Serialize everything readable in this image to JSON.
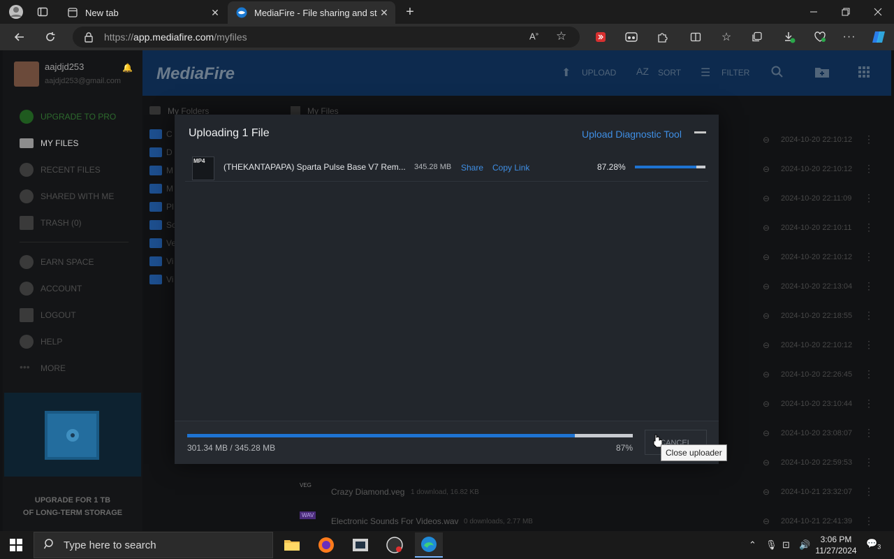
{
  "browser": {
    "tabs": [
      {
        "title": "New tab",
        "close": "✕"
      },
      {
        "title": "MediaFire - File sharing and stora",
        "close": "✕"
      }
    ],
    "new_tab": "+",
    "url_prefix": "https://",
    "url_host": "app.mediafire.com",
    "url_path": "/myfiles"
  },
  "sidebar": {
    "user_name": "aajdjd253",
    "user_email": "aajdjd253@gmail.com",
    "items": [
      {
        "label": "UPGRADE TO PRO"
      },
      {
        "label": "MY FILES"
      },
      {
        "label": "RECENT FILES"
      },
      {
        "label": "SHARED WITH ME"
      },
      {
        "label": "TRASH (0)"
      },
      {
        "label": "EARN SPACE"
      },
      {
        "label": "ACCOUNT"
      },
      {
        "label": "LOGOUT"
      },
      {
        "label": "HELP"
      },
      {
        "label": "MORE"
      }
    ],
    "promo_line1": "UPGRADE FOR 1 TB",
    "promo_line2": "OF LONG-TERM STORAGE"
  },
  "topbar": {
    "logo": "MediaFire",
    "upload": "UPLOAD",
    "sort": "SORT",
    "filter": "FILTER"
  },
  "breadcrumbs": {
    "left": "My Folders",
    "right": "My Files"
  },
  "folders": [
    "C",
    "D",
    "M",
    "M",
    "Pl",
    "So",
    "Ve",
    "Vi",
    "Vi"
  ],
  "rows": [
    {
      "date": "2024-10-20 22:10:12"
    },
    {
      "date": "2024-10-20 22:10:12"
    },
    {
      "date": "2024-10-20 22:11:09"
    },
    {
      "date": "2024-10-20 22:10:11"
    },
    {
      "date": "2024-10-20 22:10:12"
    },
    {
      "date": "2024-10-20 22:13:04"
    },
    {
      "date": "2024-10-20 22:18:55"
    },
    {
      "date": "2024-10-20 22:10:12"
    },
    {
      "date": "2024-10-20 22:26:45"
    },
    {
      "date": "2024-10-20 23:10:44"
    },
    {
      "date": "2024-10-20 23:08:07"
    },
    {
      "date": "2024-10-20 22:59:53"
    },
    {
      "date": "2024-10-21 23:32:07"
    },
    {
      "date": "2024-10-21 22:41:39"
    }
  ],
  "visible_files": [
    {
      "tag": "VEG",
      "name": "Crazy Diamond.veg",
      "meta": "1 download, 16.82 KB"
    },
    {
      "tag": "WAV",
      "name": "Electronic Sounds For Videos.wav",
      "meta": "0 downloads, 2.77 MB"
    }
  ],
  "uploader": {
    "title": "Uploading 1 File",
    "diagnostic": "Upload Diagnostic Tool",
    "file_type": "MP4",
    "file_name": "(THEKANTAPAPA) Sparta Pulse Base V7 Rem...",
    "file_size": "345.28 MB",
    "share": "Share",
    "copy_link": "Copy Link",
    "file_percent_text": "87.28%",
    "file_progress": 0.8728,
    "total_text": "301.34 MB / 345.28 MB",
    "total_percent_text": "87%",
    "total_progress": 0.87,
    "cancel": "CANCEL",
    "tooltip": "Close uploader"
  },
  "taskbar": {
    "search_placeholder": "Type here to search",
    "time": "3:06 PM",
    "date": "11/27/2024",
    "notification_count": "3"
  },
  "colors": {
    "accent": "#1e73d2",
    "link": "#3f8fe5",
    "mediafire_bar": "#0d2a4e"
  }
}
